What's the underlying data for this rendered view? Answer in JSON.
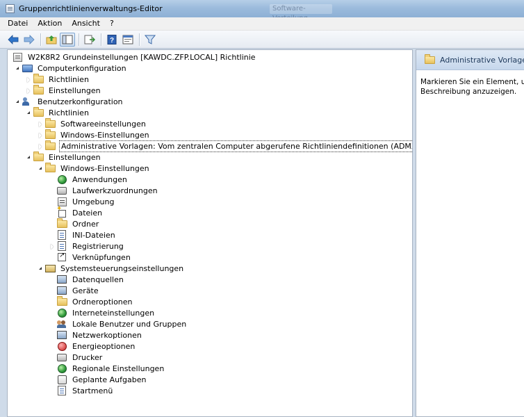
{
  "window": {
    "title": "Gruppenrichtlinienverwaltungs-Editor",
    "background_title": "Software-Verteilung",
    "colors": {
      "titlebar": "#9cbbdc",
      "selection_border": "#333333",
      "pane_header": "#c6d7ec"
    }
  },
  "menu": [
    "Datei",
    "Aktion",
    "Ansicht",
    "?"
  ],
  "toolbar": [
    "back-arrow-icon",
    "forward-arrow-icon",
    "up-folder-icon",
    "show-hide-tree-icon",
    "export-list-icon",
    "help-icon",
    "properties-icon",
    "filter-icon"
  ],
  "tree": {
    "root": "W2K8R2 Grundeinstellungen [KAWDC.ZFP.LOCAL] Richtlinie",
    "items": [
      {
        "label": "Computerkonfiguration",
        "icon": "computer-icon",
        "state": "expanded"
      },
      {
        "label": "Richtlinien",
        "icon": "folder-icon",
        "state": "collapsed"
      },
      {
        "label": "Einstellungen",
        "icon": "folder-icon",
        "state": "collapsed"
      },
      {
        "label": "Benutzerkonfiguration",
        "icon": "users-icon",
        "state": "expanded"
      },
      {
        "label": "Richtlinien",
        "icon": "folder-icon",
        "state": "expanded"
      },
      {
        "label": "Softwareeinstellungen",
        "icon": "folder-icon",
        "state": "collapsed"
      },
      {
        "label": "Windows-Einstellungen",
        "icon": "folder-icon",
        "state": "collapsed"
      },
      {
        "label": "Administrative Vorlagen: Vom zentralen Computer abgerufene Richtliniendefinitionen (ADMX-Dateien).",
        "icon": "folder-icon",
        "state": "collapsed",
        "selected": true
      },
      {
        "label": "Einstellungen",
        "icon": "folder-icon",
        "state": "expanded"
      },
      {
        "label": "Windows-Einstellungen",
        "icon": "folder-icon",
        "state": "expanded"
      },
      {
        "label": "Anwendungen",
        "icon": "globe-icon"
      },
      {
        "label": "Laufwerkzuordnungen",
        "icon": "drive-icon"
      },
      {
        "label": "Umgebung",
        "icon": "environment-icon"
      },
      {
        "label": "Dateien",
        "icon": "files-icon"
      },
      {
        "label": "Ordner",
        "icon": "folder-star-icon"
      },
      {
        "label": "INI-Dateien",
        "icon": "ini-file-icon"
      },
      {
        "label": "Registrierung",
        "icon": "registry-icon",
        "state": "collapsed"
      },
      {
        "label": "Verknüpfungen",
        "icon": "shortcut-icon"
      },
      {
        "label": "Systemsteuerungseinstellungen",
        "icon": "control-panel-icon",
        "state": "expanded"
      },
      {
        "label": "Datenquellen",
        "icon": "data-source-icon"
      },
      {
        "label": "Geräte",
        "icon": "devices-icon"
      },
      {
        "label": "Ordneroptionen",
        "icon": "folder-options-icon"
      },
      {
        "label": "Interneteinstellungen",
        "icon": "internet-icon"
      },
      {
        "label": "Lokale Benutzer und Gruppen",
        "icon": "local-users-icon"
      },
      {
        "label": "Netzwerkoptionen",
        "icon": "network-icon"
      },
      {
        "label": "Energieoptionen",
        "icon": "power-icon"
      },
      {
        "label": "Drucker",
        "icon": "printer-icon"
      },
      {
        "label": "Regionale Einstellungen",
        "icon": "regional-icon"
      },
      {
        "label": "Geplante Aufgaben",
        "icon": "scheduled-task-icon"
      },
      {
        "label": "Startmenü",
        "icon": "start-menu-icon"
      }
    ]
  },
  "details": {
    "header": "Administrative Vorlagen: V",
    "description": "Markieren Sie ein Element, um d\nBeschreibung anzuzeigen."
  }
}
